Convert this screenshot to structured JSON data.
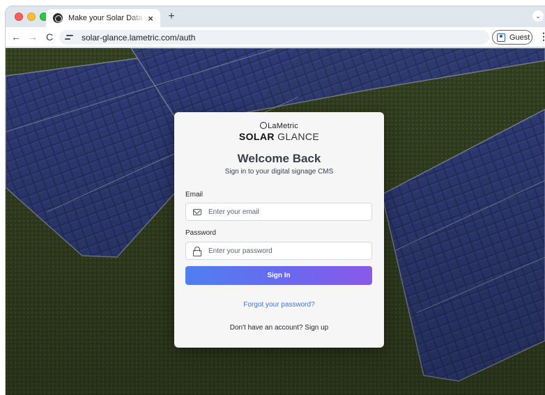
{
  "browser": {
    "tab_title": "Make your Solar Data Shine w",
    "tab_close": "×",
    "new_tab": "+",
    "url": "solar-glance.lametric.com/auth",
    "profile_label": "Guest",
    "menu_glyph": "⋮",
    "back_glyph": "←",
    "forward_glyph": "→",
    "reload_glyph": "C",
    "tab_menu_glyph": "⌄"
  },
  "brand": {
    "top": "LaMetric",
    "main_bold": "SOLAR",
    "main_light": "GLANCE"
  },
  "login": {
    "title": "Welcome Back",
    "subtitle": "Sign in to your digital signage CMS",
    "email_label": "Email",
    "email_placeholder": "Enter your email",
    "email_value": "",
    "password_label": "Password",
    "password_placeholder": "Enter your password",
    "password_value": "",
    "signin_label": "Sign In",
    "forgot_label": "Forgot your password?",
    "signup_text": "Don't have an account? Sign up"
  },
  "icons": {
    "favicon": "lametric-logo-icon",
    "site_info": "tune-icon",
    "profile": "person-badge-icon",
    "email": "mail-icon",
    "password": "lock-icon"
  },
  "colors": {
    "button_gradient_start": "#4f7ff0",
    "button_gradient_end": "#8a59ea",
    "link": "#3f73e6",
    "card_bg": "#f6f6f7"
  }
}
